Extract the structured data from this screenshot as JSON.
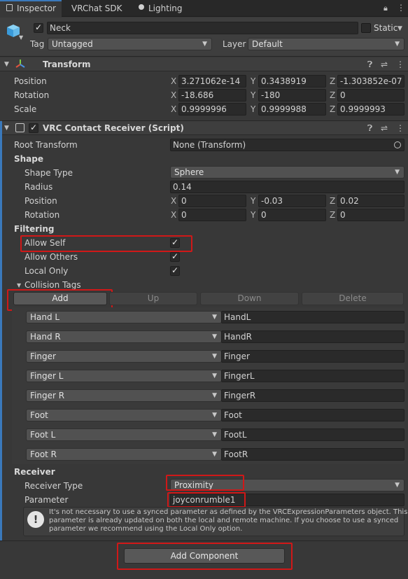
{
  "tabs": [
    {
      "label": "Inspector",
      "active": true
    },
    {
      "label": "VRChat SDK"
    },
    {
      "label": "Lighting"
    }
  ],
  "object": {
    "name": "Neck",
    "static_label": "Static",
    "tag_label": "Tag",
    "tag_value": "Untagged",
    "layer_label": "Layer",
    "layer_value": "Default"
  },
  "transform": {
    "title": "Transform",
    "rows": [
      {
        "label": "Position",
        "x": "3.271062e-14",
        "y": "0.3438919",
        "z": "-1.303852e-07"
      },
      {
        "label": "Rotation",
        "x": "-18.686",
        "y": "-180",
        "z": "0"
      },
      {
        "label": "Scale",
        "x": "0.9999996",
        "y": "0.9999988",
        "z": "0.9999993"
      }
    ]
  },
  "axes": {
    "x": "X",
    "y": "Y",
    "z": "Z"
  },
  "component": {
    "title": "VRC Contact Receiver (Script)",
    "root_transform_label": "Root Transform",
    "root_transform_value": "None (Transform)",
    "shape_header": "Shape",
    "shape_type_label": "Shape Type",
    "shape_type_value": "Sphere",
    "radius_label": "Radius",
    "radius_value": "0.14",
    "position_label": "Position",
    "position": {
      "x": "0",
      "y": "-0.03",
      "z": "0.02"
    },
    "rotation_label": "Rotation",
    "rotation": {
      "x": "0",
      "y": "0",
      "z": "0"
    },
    "filtering_header": "Filtering",
    "allow_self_label": "Allow Self",
    "allow_others_label": "Allow Others",
    "local_only_label": "Local Only",
    "collision_tags_label": "Collision Tags",
    "buttons": {
      "add": "Add",
      "up": "Up",
      "down": "Down",
      "delete": "Delete"
    },
    "tags": [
      {
        "dropdown": "Hand L",
        "value": "HandL"
      },
      {
        "dropdown": "Hand R",
        "value": "HandR"
      },
      {
        "dropdown": "Finger",
        "value": "Finger"
      },
      {
        "dropdown": "Finger L",
        "value": "FingerL"
      },
      {
        "dropdown": "Finger R",
        "value": "FingerR"
      },
      {
        "dropdown": "Foot",
        "value": "Foot"
      },
      {
        "dropdown": "Foot L",
        "value": "FootL"
      },
      {
        "dropdown": "Foot R",
        "value": "FootR"
      }
    ],
    "receiver_header": "Receiver",
    "receiver_type_label": "Receiver Type",
    "receiver_type_value": "Proximity",
    "parameter_label": "Parameter",
    "parameter_value": "joyconrumble1",
    "info_line1": "It's not necessary to use a synced parameter as defined by the VRCExpressionParameters object.  This",
    "info_line2": "parameter is already updated on both the local and remote machine.  If you choose to use a synced",
    "info_line3": "parameter we recommend using the Local Only option."
  },
  "add_component_label": "Add Component",
  "colors": {
    "highlight": "#d01818",
    "accent_bar": "#3a79bb",
    "background": "#383838"
  }
}
